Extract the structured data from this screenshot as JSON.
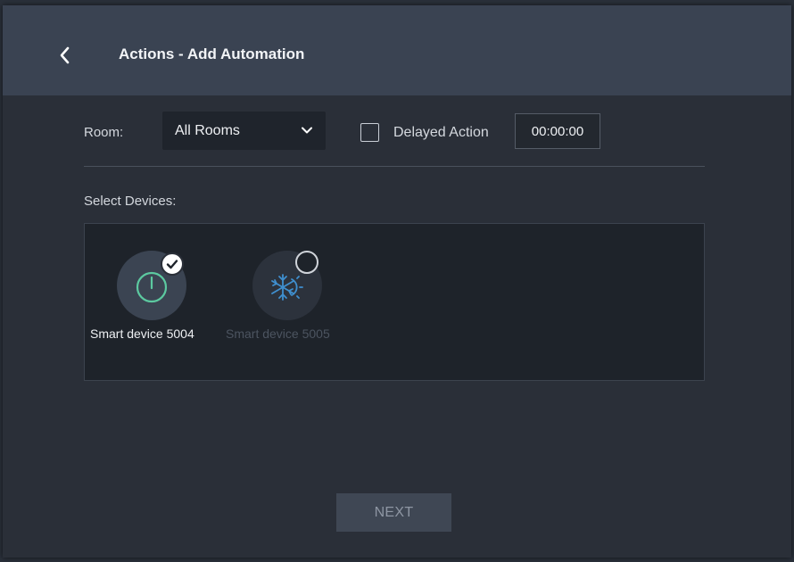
{
  "header": {
    "title": "Actions - Add Automation",
    "back_icon": "chevron-left-icon"
  },
  "filters": {
    "room_label": "Room:",
    "room_selected": "All Rooms",
    "delayed_action_label": "Delayed Action",
    "delayed_action_checked": false,
    "delay_time": "00:00:00"
  },
  "devices": {
    "section_label": "Select Devices:",
    "items": [
      {
        "name": "Smart device 5004",
        "icon": "power-icon",
        "selected": true
      },
      {
        "name": "Smart device 5005",
        "icon": "snowflake-sun-icon",
        "selected": false
      }
    ]
  },
  "footer": {
    "next_label": "NEXT"
  },
  "colors": {
    "header_bg": "#3a4352",
    "body_bg": "#2a2f38",
    "accent_green": "#5cc9a0",
    "accent_blue": "#3f8fcf"
  }
}
